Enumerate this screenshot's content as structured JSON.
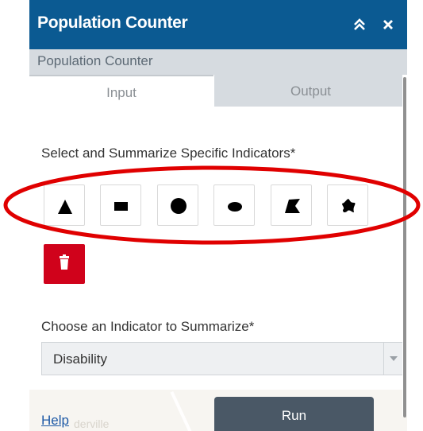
{
  "window": {
    "title": "Population Counter",
    "collapse_icon": "double-chevron-up-icon",
    "close_icon": "close-icon"
  },
  "subheader": {
    "title": "Population Counter"
  },
  "tabs": [
    {
      "label": "Input",
      "active": true
    },
    {
      "label": "Output",
      "active": false
    }
  ],
  "indicators": {
    "label": "Select and Summarize Specific Indicators*",
    "tools": [
      {
        "name": "draw-triangle-button",
        "icon": "triangle-icon"
      },
      {
        "name": "draw-rectangle-button",
        "icon": "rectangle-icon"
      },
      {
        "name": "draw-circle-button",
        "icon": "circle-icon"
      },
      {
        "name": "draw-ellipse-button",
        "icon": "ellipse-icon"
      },
      {
        "name": "draw-polygon-button",
        "icon": "polygon-icon"
      },
      {
        "name": "draw-freehand-button",
        "icon": "freehand-icon"
      }
    ],
    "clear_icon": "trash-icon"
  },
  "summarize": {
    "label": "Choose an Indicator to Summarize*",
    "selected": "Disability"
  },
  "footer": {
    "help_label": "Help",
    "run_label": "Run",
    "map_label": "derville"
  },
  "colors": {
    "titlebar": "#0b5a92",
    "subheader": "#d6dbe0",
    "trash": "#d0021b",
    "run_button": "#4a5866",
    "highlight_ellipse": "#e00000",
    "link": "#1f5aa6"
  }
}
